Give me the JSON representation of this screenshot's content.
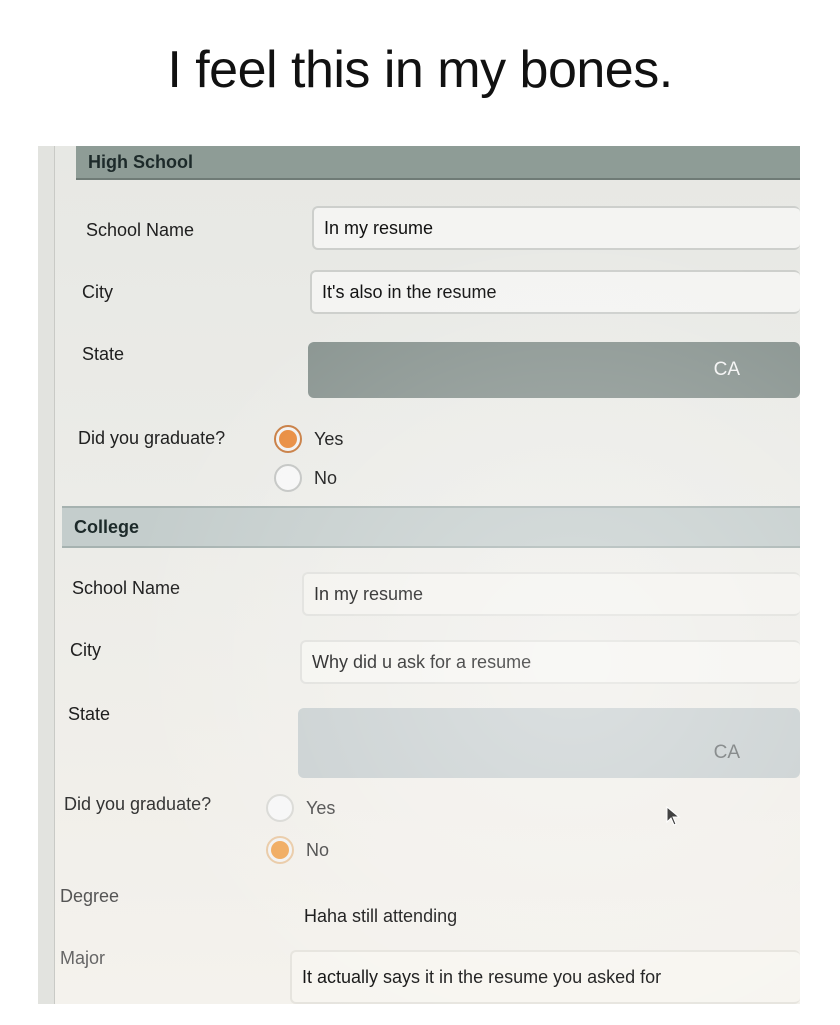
{
  "caption": "I feel this in my bones.",
  "high_school": {
    "section_title": "High School",
    "school_name_label": "School Name",
    "school_name_value": "In my resume",
    "city_label": "City",
    "city_value": "It's also in the resume",
    "state_label": "State",
    "state_value": "CA",
    "graduate_label": "Did you graduate?",
    "yes_label": "Yes",
    "no_label": "No",
    "graduated": "Yes"
  },
  "college": {
    "section_title": "College",
    "school_name_label": "School Name",
    "school_name_value": "In my resume",
    "city_label": "City",
    "city_value": "Why did u ask for a resume",
    "state_label": "State",
    "state_value": "CA",
    "graduate_label": "Did you graduate?",
    "yes_label": "Yes",
    "no_label": "No",
    "graduated": "No",
    "degree_label": "Degree",
    "degree_value": "Haha still attending",
    "major_label": "Major",
    "major_value": "It actually says it in the resume you asked for"
  },
  "colors": {
    "radio_selected": "#e88a3c",
    "high_school_bar": "#8e9c96",
    "college_bar": "#c4cdcc"
  }
}
